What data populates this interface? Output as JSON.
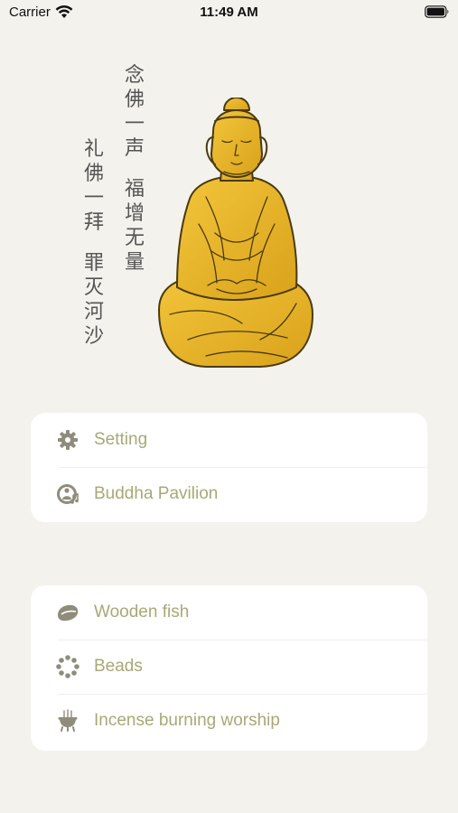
{
  "status_bar": {
    "carrier": "Carrier",
    "time": "11:49 AM",
    "icons": [
      "wifi-icon",
      "battery-icon"
    ]
  },
  "header": {
    "poem": {
      "right_top": [
        "念",
        "佛",
        "一",
        "声"
      ],
      "right_bottom": [
        "福",
        "增",
        "无",
        "量"
      ],
      "left_top": [
        "礼",
        "佛",
        "一",
        "拜"
      ],
      "left_bottom": [
        "罪",
        "灭",
        "河",
        "沙"
      ]
    },
    "image": "seated-buddha-illustration"
  },
  "menu_groups": [
    {
      "items": [
        {
          "label": "Setting",
          "icon": "gear-icon"
        },
        {
          "label": "Buddha Pavilion",
          "icon": "buddha-pavilion-icon"
        }
      ]
    },
    {
      "items": [
        {
          "label": "Wooden fish",
          "icon": "wooden-fish-icon"
        },
        {
          "label": "Beads",
          "icon": "beads-icon"
        },
        {
          "label": "Incense burning worship",
          "icon": "incense-burner-icon"
        }
      ]
    }
  ],
  "colors": {
    "background": "#f4f2ec",
    "card": "#ffffff",
    "label": "#a8a877",
    "icon": "#8f8c7c",
    "buddha_gold": "#e8b62a"
  }
}
